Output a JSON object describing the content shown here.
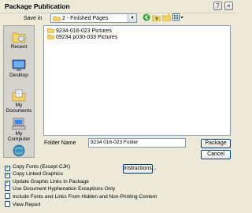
{
  "window": {
    "title": "Package Publication",
    "help_label": "?",
    "close_label": "×"
  },
  "save_in": {
    "label": "Save in",
    "value": "2 - Finished Pages",
    "dropdown_glyph": "▾"
  },
  "toolbar": {
    "back_glyph": "◀",
    "up_glyph": "↑",
    "new_folder_glyph": "✦",
    "views_glyph": "▦"
  },
  "places": [
    {
      "label": "Recent",
      "icon": "recent-folder-icon"
    },
    {
      "label": "Desktop",
      "icon": "desktop-icon"
    },
    {
      "label": "My Documents",
      "icon": "my-documents-icon"
    },
    {
      "label": "My Computer",
      "icon": "my-computer-icon"
    },
    {
      "label": "",
      "icon": "network-icon"
    }
  ],
  "files": [
    {
      "name": "9234-016-023 Pictures"
    },
    {
      "name": "09234 p030-033 Pictures"
    }
  ],
  "folder_name": {
    "label": "Folder Name",
    "value": "9234 016-023 Folder"
  },
  "buttons": {
    "package": "Package",
    "cancel": "Cancel",
    "instructions": "Instructions..."
  },
  "options": [
    {
      "label": "Copy Fonts (Except CJK)",
      "checked": true
    },
    {
      "label": "Copy Linked Graphics",
      "checked": true
    },
    {
      "label": "Update Graphic Links In Package",
      "checked": true
    },
    {
      "label": "Use Document Hyphenation Exceptions Only",
      "checked": false
    },
    {
      "label": "Include Fonts and Links From Hidden and Non-Printing Content",
      "checked": false
    },
    {
      "label": "View Report",
      "checked": false
    }
  ],
  "colors": {
    "dialog_bg": "#ece9d8",
    "field_border": "#7f9db9",
    "folder_yellow": "#f3d26b",
    "button_border": "#003c74"
  }
}
